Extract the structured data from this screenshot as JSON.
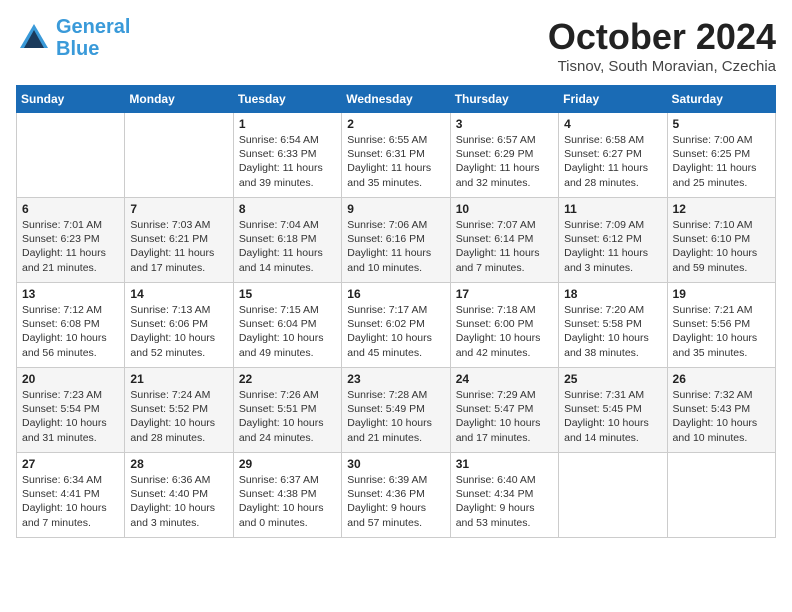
{
  "header": {
    "logo_line1": "General",
    "logo_line2": "Blue",
    "month": "October 2024",
    "location": "Tisnov, South Moravian, Czechia"
  },
  "weekdays": [
    "Sunday",
    "Monday",
    "Tuesday",
    "Wednesday",
    "Thursday",
    "Friday",
    "Saturday"
  ],
  "weeks": [
    [
      {
        "day": "",
        "info": ""
      },
      {
        "day": "",
        "info": ""
      },
      {
        "day": "1",
        "info": "Sunrise: 6:54 AM\nSunset: 6:33 PM\nDaylight: 11 hours\nand 39 minutes."
      },
      {
        "day": "2",
        "info": "Sunrise: 6:55 AM\nSunset: 6:31 PM\nDaylight: 11 hours\nand 35 minutes."
      },
      {
        "day": "3",
        "info": "Sunrise: 6:57 AM\nSunset: 6:29 PM\nDaylight: 11 hours\nand 32 minutes."
      },
      {
        "day": "4",
        "info": "Sunrise: 6:58 AM\nSunset: 6:27 PM\nDaylight: 11 hours\nand 28 minutes."
      },
      {
        "day": "5",
        "info": "Sunrise: 7:00 AM\nSunset: 6:25 PM\nDaylight: 11 hours\nand 25 minutes."
      }
    ],
    [
      {
        "day": "6",
        "info": "Sunrise: 7:01 AM\nSunset: 6:23 PM\nDaylight: 11 hours\nand 21 minutes."
      },
      {
        "day": "7",
        "info": "Sunrise: 7:03 AM\nSunset: 6:21 PM\nDaylight: 11 hours\nand 17 minutes."
      },
      {
        "day": "8",
        "info": "Sunrise: 7:04 AM\nSunset: 6:18 PM\nDaylight: 11 hours\nand 14 minutes."
      },
      {
        "day": "9",
        "info": "Sunrise: 7:06 AM\nSunset: 6:16 PM\nDaylight: 11 hours\nand 10 minutes."
      },
      {
        "day": "10",
        "info": "Sunrise: 7:07 AM\nSunset: 6:14 PM\nDaylight: 11 hours\nand 7 minutes."
      },
      {
        "day": "11",
        "info": "Sunrise: 7:09 AM\nSunset: 6:12 PM\nDaylight: 11 hours\nand 3 minutes."
      },
      {
        "day": "12",
        "info": "Sunrise: 7:10 AM\nSunset: 6:10 PM\nDaylight: 10 hours\nand 59 minutes."
      }
    ],
    [
      {
        "day": "13",
        "info": "Sunrise: 7:12 AM\nSunset: 6:08 PM\nDaylight: 10 hours\nand 56 minutes."
      },
      {
        "day": "14",
        "info": "Sunrise: 7:13 AM\nSunset: 6:06 PM\nDaylight: 10 hours\nand 52 minutes."
      },
      {
        "day": "15",
        "info": "Sunrise: 7:15 AM\nSunset: 6:04 PM\nDaylight: 10 hours\nand 49 minutes."
      },
      {
        "day": "16",
        "info": "Sunrise: 7:17 AM\nSunset: 6:02 PM\nDaylight: 10 hours\nand 45 minutes."
      },
      {
        "day": "17",
        "info": "Sunrise: 7:18 AM\nSunset: 6:00 PM\nDaylight: 10 hours\nand 42 minutes."
      },
      {
        "day": "18",
        "info": "Sunrise: 7:20 AM\nSunset: 5:58 PM\nDaylight: 10 hours\nand 38 minutes."
      },
      {
        "day": "19",
        "info": "Sunrise: 7:21 AM\nSunset: 5:56 PM\nDaylight: 10 hours\nand 35 minutes."
      }
    ],
    [
      {
        "day": "20",
        "info": "Sunrise: 7:23 AM\nSunset: 5:54 PM\nDaylight: 10 hours\nand 31 minutes."
      },
      {
        "day": "21",
        "info": "Sunrise: 7:24 AM\nSunset: 5:52 PM\nDaylight: 10 hours\nand 28 minutes."
      },
      {
        "day": "22",
        "info": "Sunrise: 7:26 AM\nSunset: 5:51 PM\nDaylight: 10 hours\nand 24 minutes."
      },
      {
        "day": "23",
        "info": "Sunrise: 7:28 AM\nSunset: 5:49 PM\nDaylight: 10 hours\nand 21 minutes."
      },
      {
        "day": "24",
        "info": "Sunrise: 7:29 AM\nSunset: 5:47 PM\nDaylight: 10 hours\nand 17 minutes."
      },
      {
        "day": "25",
        "info": "Sunrise: 7:31 AM\nSunset: 5:45 PM\nDaylight: 10 hours\nand 14 minutes."
      },
      {
        "day": "26",
        "info": "Sunrise: 7:32 AM\nSunset: 5:43 PM\nDaylight: 10 hours\nand 10 minutes."
      }
    ],
    [
      {
        "day": "27",
        "info": "Sunrise: 6:34 AM\nSunset: 4:41 PM\nDaylight: 10 hours\nand 7 minutes."
      },
      {
        "day": "28",
        "info": "Sunrise: 6:36 AM\nSunset: 4:40 PM\nDaylight: 10 hours\nand 3 minutes."
      },
      {
        "day": "29",
        "info": "Sunrise: 6:37 AM\nSunset: 4:38 PM\nDaylight: 10 hours\nand 0 minutes."
      },
      {
        "day": "30",
        "info": "Sunrise: 6:39 AM\nSunset: 4:36 PM\nDaylight: 9 hours\nand 57 minutes."
      },
      {
        "day": "31",
        "info": "Sunrise: 6:40 AM\nSunset: 4:34 PM\nDaylight: 9 hours\nand 53 minutes."
      },
      {
        "day": "",
        "info": ""
      },
      {
        "day": "",
        "info": ""
      }
    ]
  ]
}
